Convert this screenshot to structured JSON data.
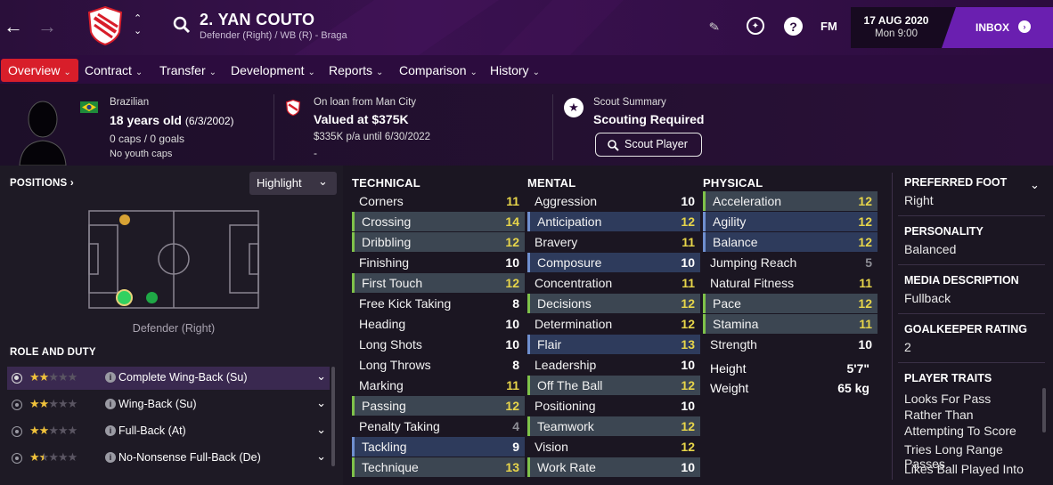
{
  "topbar": {
    "player_name": "2. YAN COUTO",
    "subtitle": "Defender (Right) / WB (R) - Braga",
    "fm_label": "FM",
    "date": "17 AUG 2020",
    "time": "Mon 9:00",
    "inbox_label": "INBOX",
    "help_label": "?"
  },
  "nav": {
    "items": [
      {
        "label": "Overview"
      },
      {
        "label": "Contract"
      },
      {
        "label": "Transfer"
      },
      {
        "label": "Development"
      },
      {
        "label": "Reports"
      },
      {
        "label": "Comparison"
      },
      {
        "label": "History"
      }
    ]
  },
  "header": {
    "nationality": "Brazilian",
    "age": "18 years old",
    "dob": "(6/3/2002)",
    "caps": "0 caps / 0 goals",
    "youth": "No youth caps",
    "loan": "On loan from Man City",
    "value": "Valued at $375K",
    "wage": "$335K p/a until 6/30/2022",
    "dash": "-",
    "scout_title": "Scout Summary",
    "scout_status": "Scouting Required",
    "scout_button": "Scout Player"
  },
  "positions": {
    "title": "POSITIONS",
    "highlight_label": "Highlight",
    "pitch_caption": "Defender (Right)",
    "role_title": "ROLE AND DUTY",
    "roles": [
      {
        "name": "Complete Wing-Back (Su)",
        "stars": 2,
        "selected": true
      },
      {
        "name": "Wing-Back (Su)",
        "stars": 2,
        "selected": false
      },
      {
        "name": "Full-Back (At)",
        "stars": 2,
        "selected": false
      },
      {
        "name": "No-Nonsense Full-Back (De)",
        "stars": 1.5,
        "selected": false
      }
    ]
  },
  "technical": {
    "title": "TECHNICAL",
    "rows": [
      {
        "name": "Corners",
        "value": "11",
        "hl": ""
      },
      {
        "name": "Crossing",
        "value": "14",
        "hl": "g"
      },
      {
        "name": "Dribbling",
        "value": "12",
        "hl": "g"
      },
      {
        "name": "Finishing",
        "value": "10",
        "hl": ""
      },
      {
        "name": "First Touch",
        "value": "12",
        "hl": "g"
      },
      {
        "name": "Free Kick Taking",
        "value": "8",
        "hl": ""
      },
      {
        "name": "Heading",
        "value": "10",
        "hl": ""
      },
      {
        "name": "Long Shots",
        "value": "10",
        "hl": ""
      },
      {
        "name": "Long Throws",
        "value": "8",
        "hl": ""
      },
      {
        "name": "Marking",
        "value": "11",
        "hl": ""
      },
      {
        "name": "Passing",
        "value": "12",
        "hl": "g"
      },
      {
        "name": "Penalty Taking",
        "value": "4",
        "hl": ""
      },
      {
        "name": "Tackling",
        "value": "9",
        "hl": "b"
      },
      {
        "name": "Technique",
        "value": "13",
        "hl": "g"
      }
    ]
  },
  "mental": {
    "title": "MENTAL",
    "rows": [
      {
        "name": "Aggression",
        "value": "10",
        "hl": ""
      },
      {
        "name": "Anticipation",
        "value": "12",
        "hl": "b"
      },
      {
        "name": "Bravery",
        "value": "11",
        "hl": ""
      },
      {
        "name": "Composure",
        "value": "10",
        "hl": "b"
      },
      {
        "name": "Concentration",
        "value": "11",
        "hl": ""
      },
      {
        "name": "Decisions",
        "value": "12",
        "hl": "g"
      },
      {
        "name": "Determination",
        "value": "12",
        "hl": ""
      },
      {
        "name": "Flair",
        "value": "13",
        "hl": "b"
      },
      {
        "name": "Leadership",
        "value": "10",
        "hl": ""
      },
      {
        "name": "Off The Ball",
        "value": "12",
        "hl": "g"
      },
      {
        "name": "Positioning",
        "value": "10",
        "hl": ""
      },
      {
        "name": "Teamwork",
        "value": "12",
        "hl": "g"
      },
      {
        "name": "Vision",
        "value": "12",
        "hl": ""
      },
      {
        "name": "Work Rate",
        "value": "10",
        "hl": "g"
      }
    ]
  },
  "physical": {
    "title": "PHYSICAL",
    "rows": [
      {
        "name": "Acceleration",
        "value": "12",
        "hl": "g"
      },
      {
        "name": "Agility",
        "value": "12",
        "hl": "b"
      },
      {
        "name": "Balance",
        "value": "12",
        "hl": "b"
      },
      {
        "name": "Jumping Reach",
        "value": "5",
        "hl": ""
      },
      {
        "name": "Natural Fitness",
        "value": "11",
        "hl": ""
      },
      {
        "name": "Pace",
        "value": "12",
        "hl": "g"
      },
      {
        "name": "Stamina",
        "value": "11",
        "hl": "g"
      },
      {
        "name": "Strength",
        "value": "10",
        "hl": ""
      }
    ],
    "height_label": "Height",
    "height_value": "5'7\"",
    "weight_label": "Weight",
    "weight_value": "65 kg"
  },
  "side": {
    "foot_label": "PREFERRED FOOT",
    "foot_value": "Right",
    "personality_label": "PERSONALITY",
    "personality_value": "Balanced",
    "media_label": "MEDIA DESCRIPTION",
    "media_value": "Fullback",
    "gk_label": "GOALKEEPER RATING",
    "gk_value": "2",
    "traits_label": "PLAYER TRAITS",
    "traits": [
      "Looks For Pass Rather Than Attempting To Score",
      "Tries Long Range Passes",
      "Likes Ball Played Into"
    ]
  },
  "colors": {
    "accent_red": "#d81e2a",
    "inbox_purple": "#6a1fb0",
    "value_yellow": "#e7d54a",
    "highlight_green": "#7fc24a",
    "highlight_blue": "#6f8fcf"
  }
}
